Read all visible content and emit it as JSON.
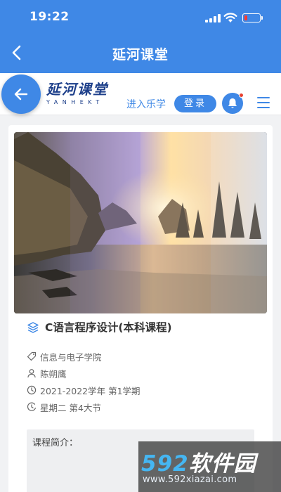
{
  "status_bar": {
    "time": "19:22",
    "battery_level": 0.2,
    "battery_color": "#ff3b30"
  },
  "app_bar": {
    "title": "延河课堂",
    "back_icon": "chevron-left-icon"
  },
  "site_header": {
    "back_icon": "arrow-left-icon",
    "brand_cn": "延河课堂",
    "brand_en": "YANHEKT",
    "enter_label": "进入乐学",
    "login_label": "登录",
    "notification_icon": "bell-icon",
    "menu_icon": "hamburger-icon"
  },
  "course": {
    "title": "C语言程序设计(本科课程)",
    "title_icon": "layers-icon",
    "hero_image": "landscape scene of rocky beach at sunset",
    "info": [
      {
        "icon": "tag-icon",
        "text": "信息与电子学院"
      },
      {
        "icon": "user-icon",
        "text": "陈朔鹰"
      },
      {
        "icon": "clock-icon",
        "text": "2021-2022学年 第1学期"
      },
      {
        "icon": "schedule-icon",
        "text": "星期二 第4大节"
      }
    ],
    "summary_label": "课程简介："
  },
  "watermark": {
    "number": "592",
    "name": "软件园",
    "url": "www.592xiazai.com"
  },
  "colors": {
    "primary": "#3f88e6",
    "brand": "#1d3f8a",
    "badge": "#e8412f"
  }
}
